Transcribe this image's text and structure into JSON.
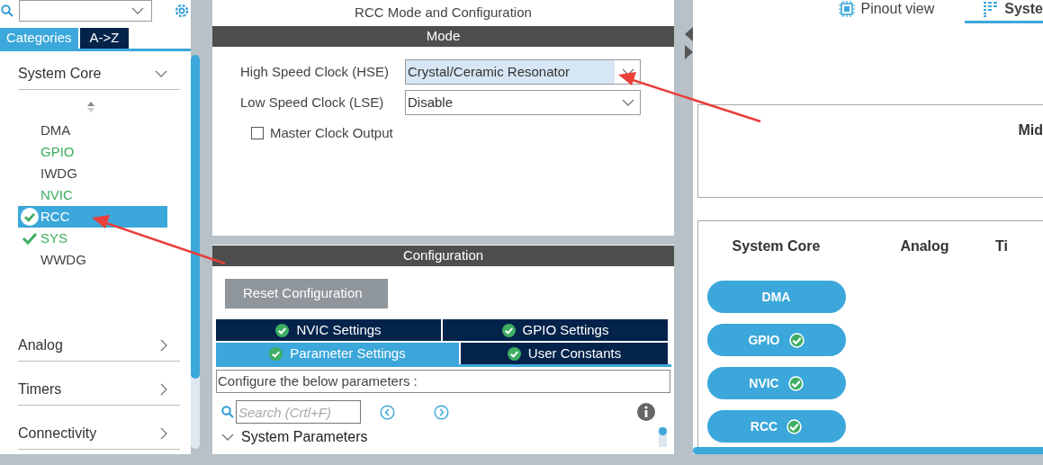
{
  "sidebar": {
    "tabs": [
      {
        "label": "Categories",
        "selected": true
      },
      {
        "label": "A->Z",
        "selected": false
      }
    ],
    "categories": [
      {
        "label": "System Core",
        "expanded": true,
        "items": [
          {
            "label": "DMA",
            "enabled": false,
            "checked": false,
            "selected": false
          },
          {
            "label": "GPIO",
            "enabled": true,
            "checked": false,
            "selected": false
          },
          {
            "label": "IWDG",
            "enabled": false,
            "checked": false,
            "selected": false
          },
          {
            "label": "NVIC",
            "enabled": true,
            "checked": false,
            "selected": false
          },
          {
            "label": "RCC",
            "checked": true,
            "selected": true
          },
          {
            "label": "SYS",
            "enabled": true,
            "checked": true,
            "selected": false
          },
          {
            "label": "WWDG",
            "enabled": false,
            "checked": false,
            "selected": false
          }
        ]
      },
      {
        "label": "Analog",
        "expanded": false
      },
      {
        "label": "Timers",
        "expanded": false
      },
      {
        "label": "Connectivity",
        "expanded": false
      }
    ]
  },
  "mode_panel": {
    "title": "RCC Mode and Configuration",
    "header": "Mode",
    "fields": [
      {
        "kind": "select",
        "label": "High Speed Clock (HSE)",
        "value": "Crystal/Ceramic Resonator",
        "highlighted": true
      },
      {
        "kind": "select",
        "label": "Low Speed Clock (LSE)",
        "value": "Disable",
        "highlighted": false
      },
      {
        "kind": "checkbox",
        "label": "Master Clock Output",
        "checked": false
      }
    ]
  },
  "configuration_panel": {
    "header": "Configuration",
    "reset_button": "Reset Configuration",
    "tab_rows": [
      [
        {
          "label": "NVIC Settings",
          "selected": false
        },
        {
          "label": "GPIO Settings",
          "selected": false
        }
      ],
      [
        {
          "label": "Parameter Settings",
          "selected": true
        },
        {
          "label": "User Constants",
          "selected": false
        }
      ]
    ],
    "description": "Configure the below parameters :",
    "search": {
      "placeholder": "Search (Crtl+F)"
    },
    "groups": [
      {
        "label": "System Parameters",
        "expanded": true
      }
    ]
  },
  "view_tabs": [
    {
      "label": "Pinout view",
      "selected": false,
      "kind": "chip"
    },
    {
      "label": "Syste",
      "selected": true,
      "kind": "list"
    }
  ],
  "system_view": {
    "top_box_title": "Mid",
    "columns": [
      {
        "title": "System Core",
        "items": [
          {
            "label": "DMA",
            "checked": false
          },
          {
            "label": "GPIO",
            "checked": true
          },
          {
            "label": "NVIC",
            "checked": true
          },
          {
            "label": "RCC",
            "checked": true
          }
        ]
      },
      {
        "title": "Analog"
      },
      {
        "title": "Ti"
      }
    ]
  }
}
